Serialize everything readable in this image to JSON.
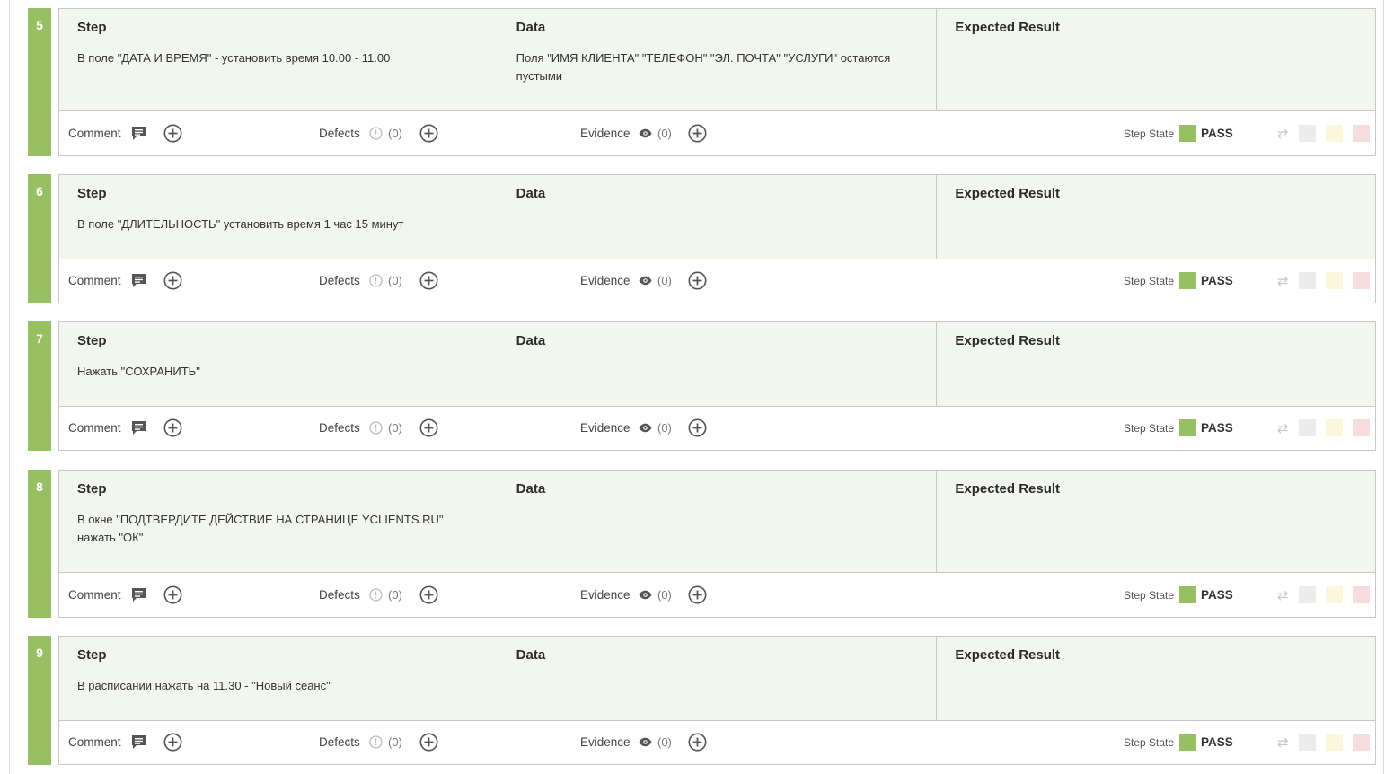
{
  "labels": {
    "step": "Step",
    "data": "Data",
    "expected": "Expected Result",
    "comment": "Comment",
    "defects": "Defects",
    "evidence": "Evidence",
    "step_state": "Step State"
  },
  "colors": {
    "pass_green": "#96c062",
    "panel_bg": "#f3f6ee",
    "border": "#c8c8c8"
  },
  "steps": [
    {
      "num": "5",
      "step_text": "В поле \"ДАТА И ВРЕМЯ\" - установить время 10.00 - 11.00",
      "data_text": "Поля \"ИМЯ КЛИЕНТА\" \"ТЕЛЕФОН\" \"ЭЛ. ПОЧТА\" \"УСЛУГИ\" остаются пустыми",
      "expected_text": "",
      "defects_count": "(0)",
      "evidence_count": "(0)",
      "state": "PASS"
    },
    {
      "num": "6",
      "step_text": "В поле \"ДЛИТЕЛЬНОСТЬ\" установить время 1 час 15 минут",
      "data_text": "",
      "expected_text": "",
      "defects_count": "(0)",
      "evidence_count": "(0)",
      "state": "PASS"
    },
    {
      "num": "7",
      "step_text": "Нажать \"СОХРАНИТЬ\"",
      "data_text": "",
      "expected_text": "",
      "defects_count": "(0)",
      "evidence_count": "(0)",
      "state": "PASS"
    },
    {
      "num": "8",
      "step_text": "В окне \"ПОДТВЕРДИТЕ ДЕЙСТВИЕ НА СТРАНИЦЕ YCLIENTS.RU\" нажать \"ОК\"",
      "data_text": "",
      "expected_text": "",
      "defects_count": "(0)",
      "evidence_count": "(0)",
      "state": "PASS"
    },
    {
      "num": "9",
      "step_text": "В расписании нажать на 11.30 - \"Новый сеанс\"",
      "data_text": "",
      "expected_text": "",
      "defects_count": "(0)",
      "evidence_count": "(0)",
      "state": "PASS"
    }
  ]
}
